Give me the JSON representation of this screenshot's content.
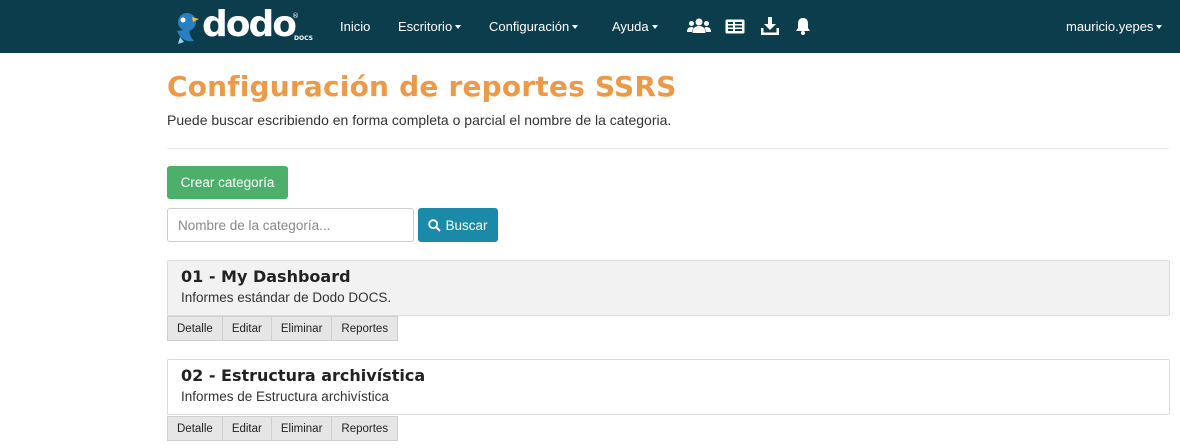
{
  "navbar": {
    "logo_text": "dodo",
    "logo_reg": "®",
    "logo_docs": "DOCS",
    "items": [
      {
        "label": "Inicio",
        "dropdown": false
      },
      {
        "label": "Escritorio",
        "dropdown": true
      },
      {
        "label": "Configuración",
        "dropdown": true
      },
      {
        "label": "Ayuda",
        "dropdown": true
      }
    ],
    "icons": [
      "users-icon",
      "id-card-icon",
      "download-icon",
      "bell-icon"
    ],
    "user": "mauricio.yepes",
    "colors": {
      "background": "#0c3d4d",
      "text": "#ffffff"
    }
  },
  "page": {
    "title": "Configuración de reportes SSRS",
    "subtitle": "Puede buscar escribiendo en forma completa o parcial el nombre de la categoria.",
    "title_color": "#ec9a48"
  },
  "toolbar": {
    "create_label": "Crear categoría",
    "search_placeholder": "Nombre de la categoría...",
    "search_value": "",
    "search_label": "Buscar",
    "create_color": "#4caf6a",
    "search_color": "#1b8aa8"
  },
  "categories": [
    {
      "title": "01 - My Dashboard",
      "description": "Informes estándar de Dodo DOCS."
    },
    {
      "title": "02 - Estructura archivística",
      "description": "Informes de Estructura archivística"
    }
  ],
  "category_actions": [
    "Detalle",
    "Editar",
    "Eliminar",
    "Reportes"
  ]
}
